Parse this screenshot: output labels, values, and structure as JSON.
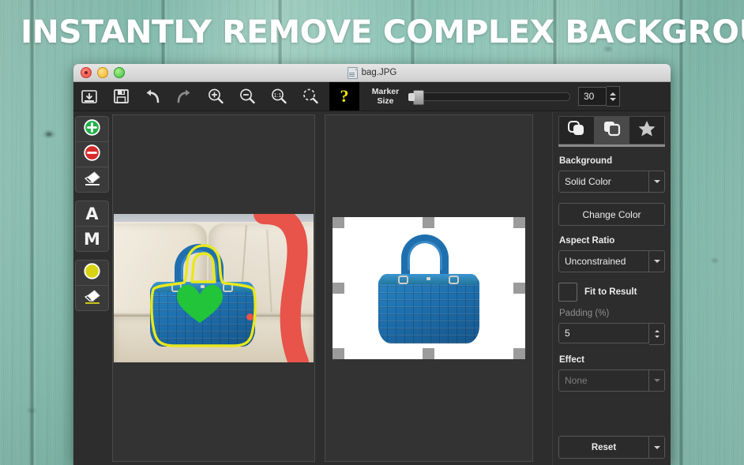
{
  "headline": "INSTANTLY REMOVE COMPLEX BACKGROUND",
  "window": {
    "title": "bag.JPG",
    "traffic_lights": [
      "close",
      "minimize",
      "maximize"
    ]
  },
  "toolbar": {
    "buttons": [
      {
        "name": "open-file",
        "icon": "folder-download-icon",
        "tooltip": "Open"
      },
      {
        "name": "save-file",
        "icon": "floppy-save-icon",
        "tooltip": "Save"
      },
      {
        "name": "undo",
        "icon": "undo-arrow-icon",
        "tooltip": "Undo"
      },
      {
        "name": "redo",
        "icon": "redo-arrow-icon",
        "tooltip": "Redo"
      },
      {
        "name": "zoom-in",
        "icon": "magnifier-plus-icon",
        "tooltip": "Zoom In"
      },
      {
        "name": "zoom-out",
        "icon": "magnifier-minus-icon",
        "tooltip": "Zoom Out"
      },
      {
        "name": "zoom-actual",
        "icon": "magnifier-1to1-icon",
        "tooltip": "1:1"
      },
      {
        "name": "zoom-fit",
        "icon": "magnifier-fit-icon",
        "tooltip": "Fit"
      }
    ],
    "help_label": "?",
    "marker_size_label": "Marker\nSize",
    "marker_size_label_line1": "Marker",
    "marker_size_label_line2": "Size",
    "marker_size_value": "30",
    "slider_percent": 4
  },
  "palette": {
    "groups": [
      {
        "tools": [
          {
            "name": "foreground-marker",
            "icon": "green-plus-icon",
            "color": "#22b14c"
          },
          {
            "name": "background-marker",
            "icon": "red-minus-icon",
            "color": "#d42b2b"
          },
          {
            "name": "marker-eraser",
            "icon": "eraser-icon",
            "color": "#ffffff"
          }
        ]
      },
      {
        "tools": [
          {
            "name": "auto-mode",
            "icon": "letter-a-icon",
            "label": "A"
          },
          {
            "name": "manual-mode",
            "icon": "letter-m-icon",
            "label": "M"
          }
        ]
      },
      {
        "tools": [
          {
            "name": "outline-marker",
            "icon": "yellow-circle-icon",
            "color": "#d8d414"
          },
          {
            "name": "outline-eraser",
            "icon": "yellow-eraser-icon",
            "color": "#d8d414"
          }
        ]
      }
    ]
  },
  "canvas": {
    "source_label": "source-image",
    "result_label": "result-image",
    "markers": {
      "foreground": "green",
      "background": "red",
      "outline": "yellow"
    },
    "crop_handles": 8
  },
  "options": {
    "tabs": [
      {
        "name": "tab-layers",
        "icon": "rounded-stack-icon",
        "active": false
      },
      {
        "name": "tab-background",
        "icon": "square-stack-icon",
        "active": true
      },
      {
        "name": "tab-effects",
        "icon": "star-icon",
        "active": false
      }
    ],
    "background_label": "Background",
    "background_value": "Solid Color",
    "change_color_label": "Change Color",
    "aspect_ratio_label": "Aspect Ratio",
    "aspect_ratio_value": "Unconstrained",
    "fit_to_result_label": "Fit to Result",
    "fit_to_result_checked": false,
    "padding_label": "Padding (%)",
    "padding_value": "5",
    "effect_label": "Effect",
    "effect_value": "None",
    "reset_label": "Reset"
  },
  "colors": {
    "accent_yellow": "#f5e400",
    "bag_blue": "#1d6fae",
    "marker_green": "#22b14c",
    "marker_red": "#e8534a",
    "marker_yellow": "#e8e81c",
    "wood_teal": "#8fcbbd",
    "panel_dark": "#2d2d2d"
  }
}
